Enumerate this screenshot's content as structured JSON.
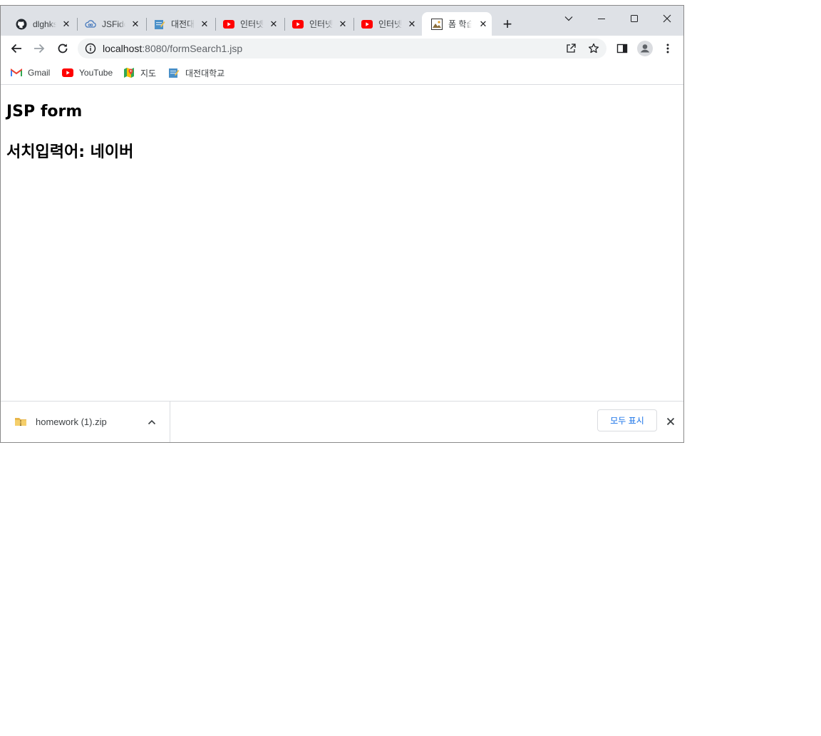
{
  "tabs": [
    {
      "title": "dlghks",
      "icon": "github-icon",
      "close_icon": "close-icon"
    },
    {
      "title": "JSFiddle",
      "icon": "jsfiddle-cloud-icon",
      "close_icon": "close-icon"
    },
    {
      "title": "대전대학교",
      "icon": "daejeon-univ-icon",
      "close_icon": "close-icon"
    },
    {
      "title": "인터넷",
      "icon": "youtube-icon",
      "close_icon": "close-icon"
    },
    {
      "title": "인터넷",
      "icon": "youtube-icon",
      "close_icon": "close-icon"
    },
    {
      "title": "인터넷",
      "icon": "youtube-icon",
      "close_icon": "close-icon"
    },
    {
      "title": "폼 학습",
      "icon": "page-image-icon",
      "close_icon": "close-icon",
      "active": true
    }
  ],
  "new_tab_label": "+",
  "address_bar": {
    "host": "localhost",
    "path": ":8080/formSearch1.jsp"
  },
  "bookmarks": [
    {
      "label": "Gmail",
      "icon": "gmail-icon"
    },
    {
      "label": "YouTube",
      "icon": "youtube-icon"
    },
    {
      "label": "지도",
      "icon": "maps-icon"
    },
    {
      "label": "대전대학교",
      "icon": "daejeon-univ-icon"
    }
  ],
  "page": {
    "heading": "JSP form",
    "result": "서치입력어: 네이버"
  },
  "download_bar": {
    "file_name": "homework (1).zip",
    "file_icon": "zip-folder-icon",
    "show_all_label": "모두 표시"
  },
  "colors": {
    "tab_strip_bg": "#dee1e6",
    "omnibox_bg": "#f1f3f4",
    "youtube_red": "#ff0000",
    "show_all_text": "#1a73e8"
  }
}
